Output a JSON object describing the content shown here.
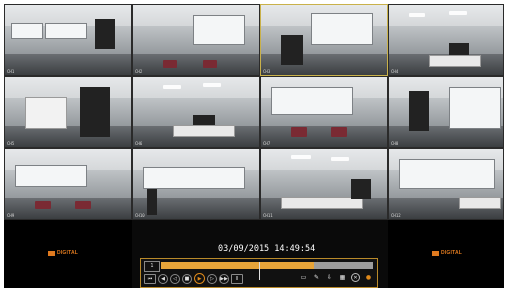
{
  "cameras": [
    {
      "label": "CH1"
    },
    {
      "label": "CH2"
    },
    {
      "label": "CH3"
    },
    {
      "label": "CH4"
    },
    {
      "label": "CH5"
    },
    {
      "label": "CH6"
    },
    {
      "label": "CH7"
    },
    {
      "label": "CH8"
    },
    {
      "label": "CH9"
    },
    {
      "label": "CH10"
    },
    {
      "label": "CH11"
    },
    {
      "label": "CH12"
    }
  ],
  "overlay": {
    "datetime": "03/09/2015 14:49:54",
    "brand_left": "DIGITAL",
    "brand_right": "DIGITAL"
  },
  "playback": {
    "channel_box": "1",
    "progress_fraction": 0.72,
    "buttons": [
      "rewind",
      "step-back",
      "stop",
      "play",
      "step-forward",
      "fast-forward",
      "frame"
    ],
    "tools": [
      "display-icon",
      "edit-icon",
      "download-icon",
      "calendar-icon",
      "close-icon",
      "color-icon"
    ]
  },
  "colors": {
    "accent": "#e8a53a",
    "panel_border": "#b98a2a",
    "selected_border": "#c9b14a"
  }
}
